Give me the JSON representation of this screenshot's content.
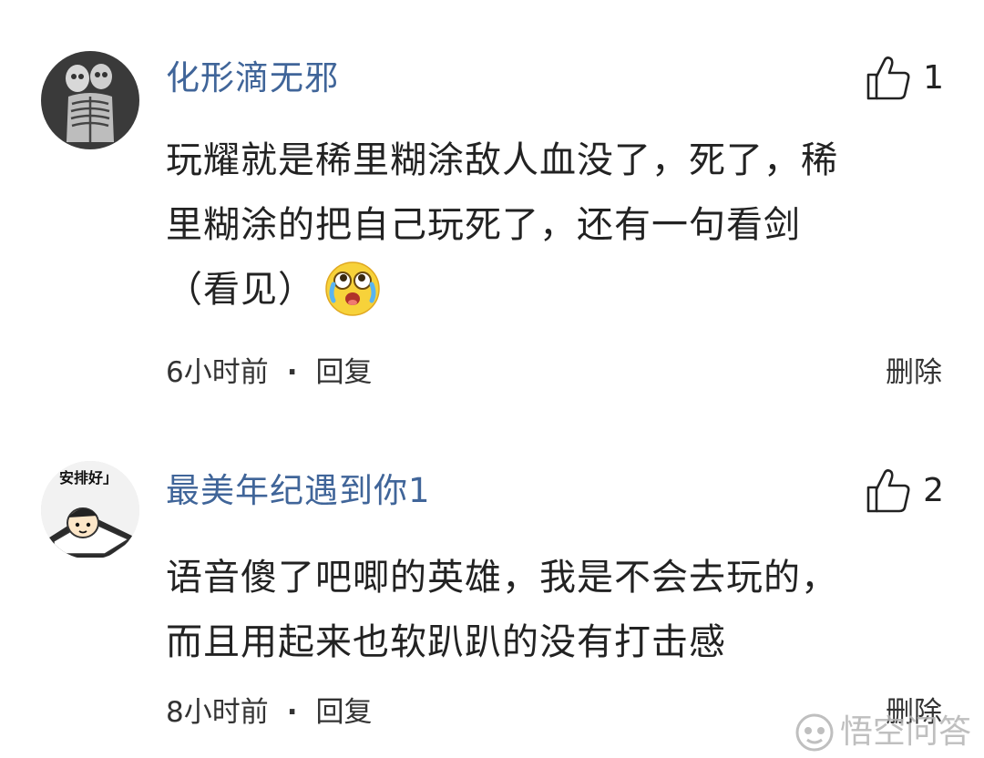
{
  "comments": [
    {
      "username": "化形滴无邪",
      "like_count": "1",
      "content_lines": [
        "玩耀就是稀里糊涂敌人血没了，死了，稀",
        "里糊涂的把自己玩死了，还有一句看剑",
        "（看见）"
      ],
      "emoji": "crying-laughing-emoji",
      "time": "6小时前",
      "separator": "·",
      "reply_label": "回复",
      "delete_label": "删除"
    },
    {
      "username": "最美年纪遇到你1",
      "like_count": "2",
      "avatar_caption": "安排好」",
      "content_lines": [
        "语音傻了吧唧的英雄，我是不会去玩的，",
        "而且用起来也软趴趴的没有打击感"
      ],
      "time": "8小时前",
      "separator": "·",
      "reply_label": "回复",
      "delete_label": "删除"
    }
  ],
  "watermark": {
    "text": "悟空问答",
    "icon": "wukong-logo-icon"
  },
  "colors": {
    "username": "#406599",
    "text": "#222222",
    "meta": "#333333"
  }
}
